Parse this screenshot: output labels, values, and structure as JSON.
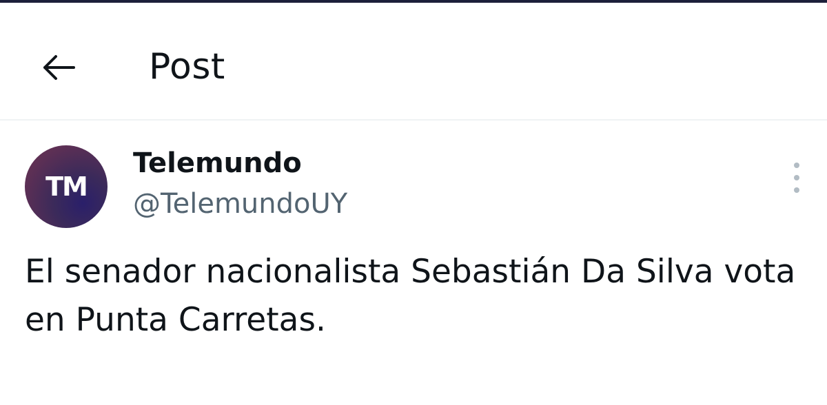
{
  "header": {
    "title": "Post",
    "back_icon": "arrow-left-icon"
  },
  "post": {
    "avatar_text": "TM",
    "display_name": "Telemundo",
    "handle": "@TelemundoUY",
    "text": "El senador nacionalista Sebastián Da Silva vota en Punta Carretas.",
    "more_icon": "more-vertical-icon"
  },
  "colors": {
    "text": "#0f1419",
    "secondary_text": "#536471",
    "divider": "#eff3f4",
    "avatar_bg": "#3b2a5a"
  }
}
